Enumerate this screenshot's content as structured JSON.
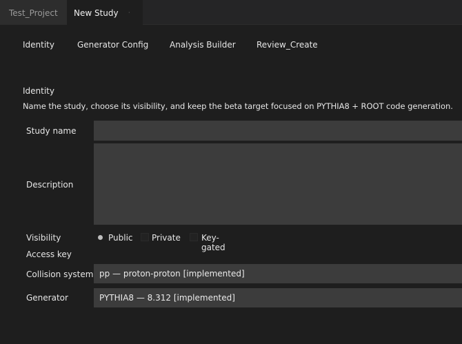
{
  "tabs": {
    "project": "Test_Project",
    "study": "New Study",
    "close_glyph": "·"
  },
  "sections": {
    "identity": "Identity",
    "generator_config": "Generator Config",
    "analysis_builder": "Analysis Builder",
    "review_create": "Review_Create"
  },
  "header": {
    "title": "Identity",
    "subtitle": "Name the study, choose its visibility, and keep the beta target focused on PYTHIA8 + ROOT code generation."
  },
  "form": {
    "study_name_label": "Study name",
    "study_name_value": "",
    "description_label": "Description",
    "description_value": "",
    "visibility_label": "Visibility",
    "visibility_options": {
      "public": "Public",
      "private": "Private",
      "key_gated": "Key-gated"
    },
    "visibility_selected": "Public",
    "access_key_label": "Access key",
    "collision_label": "Collision system",
    "collision_value": "pp — proton-proton [implemented]",
    "generator_label": "Generator",
    "generator_value": "PYTHIA8 — 8.312 [implemented]"
  }
}
